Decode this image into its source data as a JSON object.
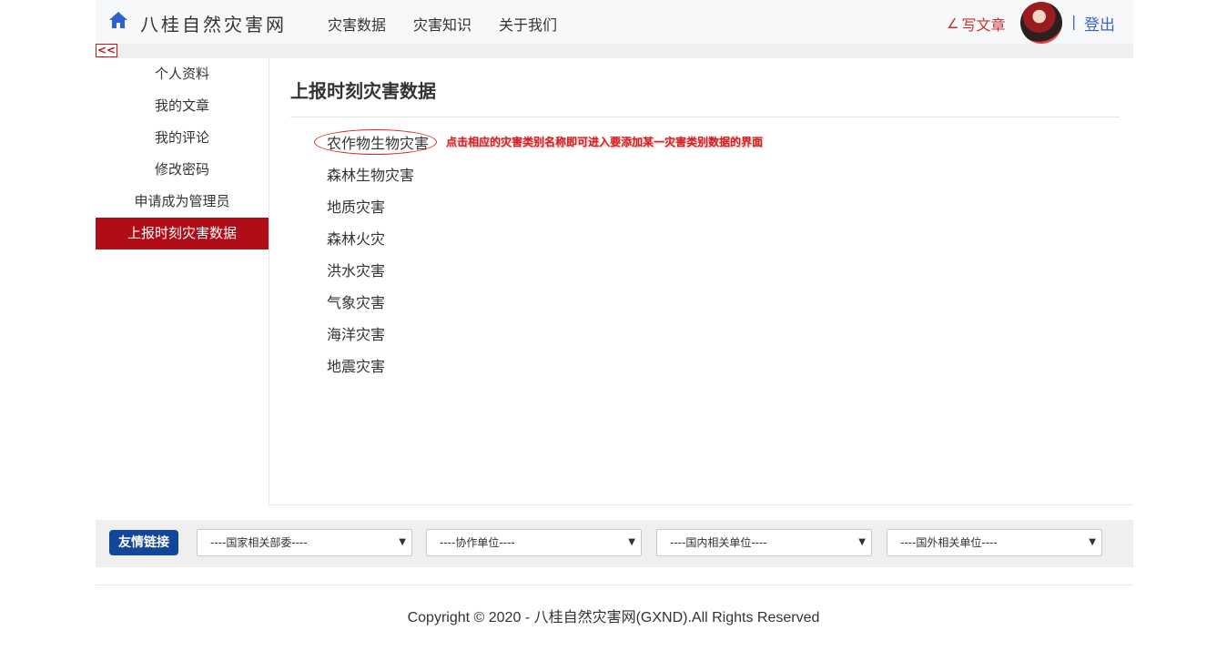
{
  "header": {
    "site_title": "八桂自然灾害网",
    "nav": [
      "灾害数据",
      "灾害知识",
      "关于我们"
    ],
    "write_label": "写文章",
    "separator": "|",
    "logout_label": "登出"
  },
  "collapse_label": "<<",
  "sidebar": {
    "items": [
      "个人资料",
      "我的文章",
      "我的评论",
      "修改密码",
      "申请成为管理员",
      "上报时刻灾害数据"
    ],
    "active_index": 5
  },
  "main": {
    "title": "上报时刻灾害数据",
    "categories": [
      "农作物生物灾害",
      "森林生物灾害",
      "地质灾害",
      "森林火灾",
      "洪水灾害",
      "气象灾害",
      "海洋灾害",
      "地震灾害"
    ],
    "hint": "点击相应的灾害类别名称即可进入要添加某一灾害类别数据的界面"
  },
  "links": {
    "label": "友情链接",
    "selects": [
      "----国家相关部委----",
      "----协作单位----",
      "----国内相关单位----",
      "----国外相关单位----"
    ]
  },
  "footer": {
    "copyright": "Copyright © 2020 - 八桂自然灾害网(GXND).All Rights Reserved"
  },
  "colors": {
    "accent_red": "#b00d17",
    "link_blue": "#3b63c7",
    "button_blue": "#12469a"
  }
}
